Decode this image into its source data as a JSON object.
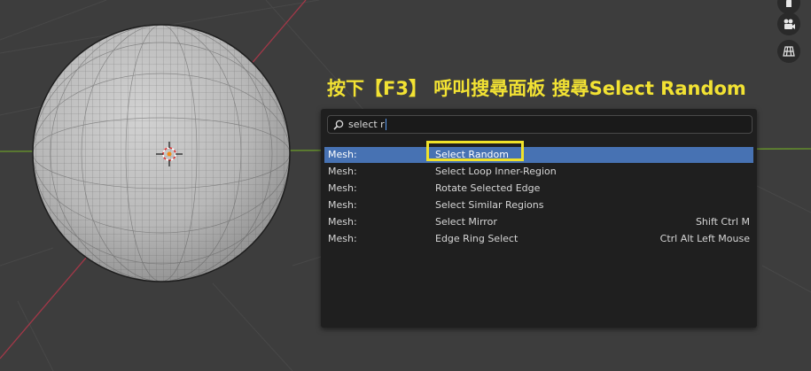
{
  "annotation": {
    "text": "按下【F3】 呼叫搜尋面板  搜尋Select Random"
  },
  "search": {
    "query": "select r"
  },
  "results": [
    {
      "category": "Mesh:",
      "operator": "Select Random",
      "shortcut": "",
      "selected": true
    },
    {
      "category": "Mesh:",
      "operator": "Select Loop Inner-Region",
      "shortcut": ""
    },
    {
      "category": "Mesh:",
      "operator": "Rotate Selected Edge",
      "shortcut": ""
    },
    {
      "category": "Mesh:",
      "operator": "Select Similar Regions",
      "shortcut": ""
    },
    {
      "category": "Mesh:",
      "operator": "Select Mirror",
      "shortcut": "Shift Ctrl M"
    },
    {
      "category": "Mesh:",
      "operator": "Edge Ring Select",
      "shortcut": "Ctrl Alt Left Mouse"
    }
  ],
  "icons": [
    "hand-icon",
    "camera-icon",
    "grid-icon",
    "search-icon"
  ],
  "colors": {
    "highlight": "#f0e22a",
    "annotation": "#f2e233",
    "selected_row": "#4772b3",
    "x_axis": "#a33848",
    "y_axis": "#6a9a2a"
  }
}
